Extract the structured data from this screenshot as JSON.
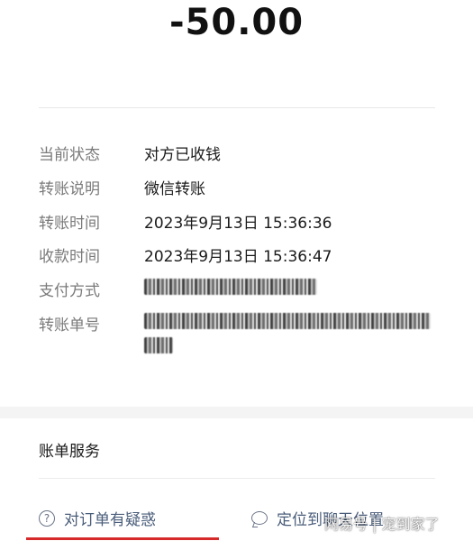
{
  "transaction": {
    "amount": "-50.00"
  },
  "details": [
    {
      "label": "当前状态",
      "value": "对方已收钱"
    },
    {
      "label": "转账说明",
      "value": "微信转账"
    },
    {
      "label": "转账时间",
      "value": "2023年9月13日 15:36:36"
    },
    {
      "label": "收款时间",
      "value": "2023年9月13日 15:36:47"
    },
    {
      "label": "支付方式",
      "value": ""
    },
    {
      "label": "转账单号",
      "value": ""
    }
  ],
  "bill_service": {
    "title": "账单服务",
    "actions": [
      {
        "label": "对订单有疑惑",
        "icon": "question-circle-icon"
      },
      {
        "label": "定位到聊天位置",
        "icon": "chat-bubble-icon"
      }
    ]
  },
  "watermark": "网易号 | 宠到家了",
  "colors": {
    "label_gray": "#7a7a7a",
    "action_blue_gray": "#4a5d7a",
    "highlight_red": "#d62a2a"
  }
}
